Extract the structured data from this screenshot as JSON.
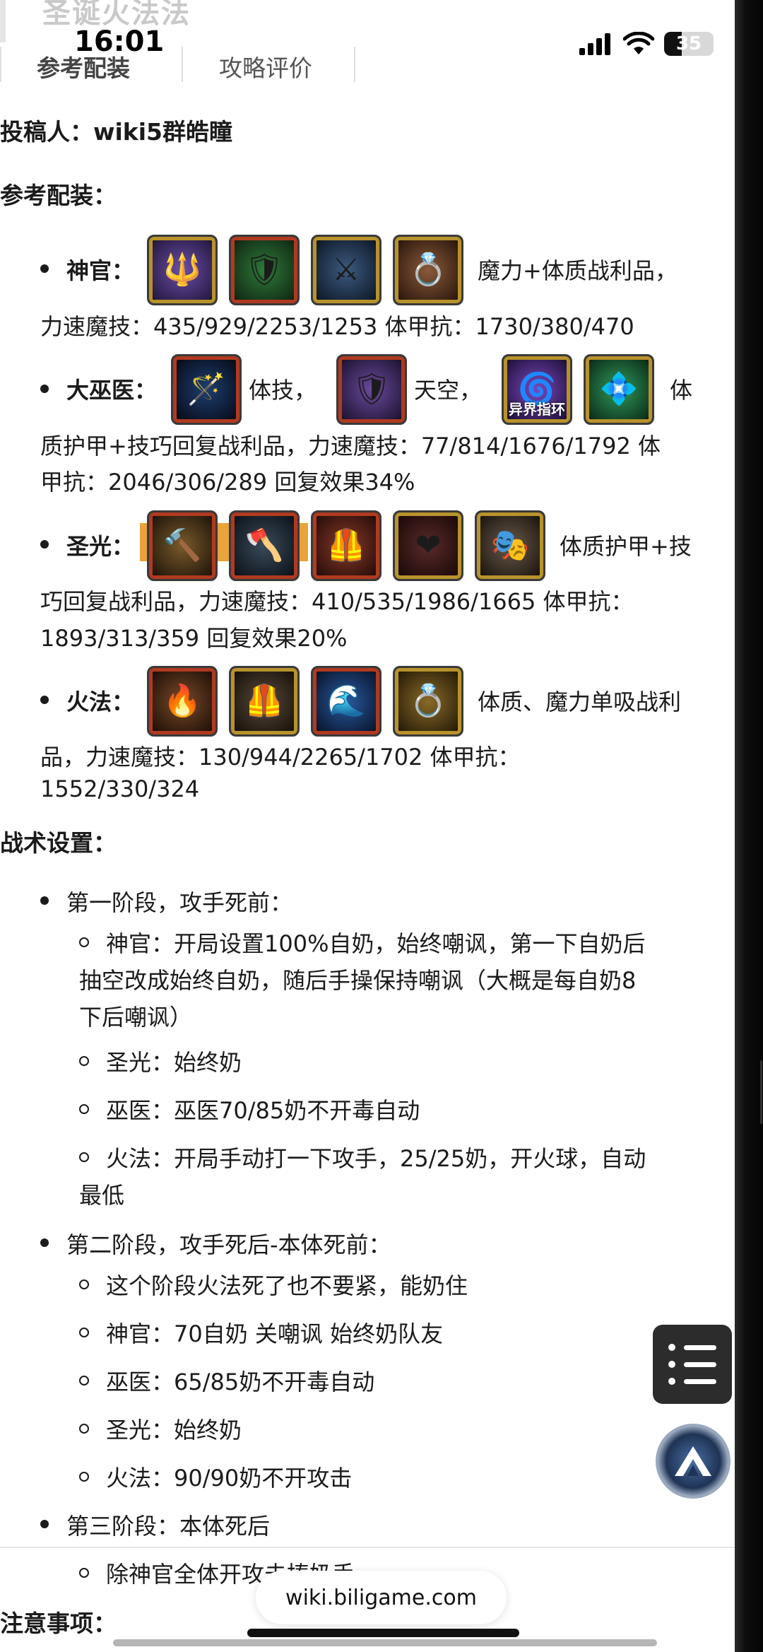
{
  "page": {
    "faded_title": "圣诞火法法",
    "url": "wiki.biligame.com"
  },
  "status_bar": {
    "time": "16:01",
    "battery": "35",
    "battery_level": 0.35
  },
  "tabs": [
    "参考配装",
    "攻略评价"
  ],
  "author": "投稿人：wiki5群皓瞳",
  "section_gear": "参考配装：",
  "priest": {
    "label": "神官：",
    "trail": "魔力+体质战利品，",
    "stats": "力速魔技：435/929/2253/1253 体甲抗：1730/380/470"
  },
  "shaman": {
    "label": "大巫医：",
    "t1": "体技，",
    "t2": "天空，",
    "t3": "体",
    "ring_tag": "异界指环",
    "line2": "质护甲+技巧回复战利品，力速魔技：77/814/1676/1792 体",
    "line3": "甲抗：2046/306/289 回复效果34%"
  },
  "paladin": {
    "label": "圣光：",
    "trail": "体质护甲+技",
    "line2": "巧回复战利品，力速魔技：410/535/1986/1665 体甲抗：",
    "line3": "1893/313/359 回复效果20%"
  },
  "firemage": {
    "label": "火法：",
    "trail": "体质、魔力单吸战利",
    "line2": "品，力速魔技：130/944/2265/1702 体甲抗：",
    "line3": "1552/330/324"
  },
  "section_tactics": "战术设置：",
  "phase1": {
    "title": "第一阶段，攻手死前：",
    "items": [
      "神官：开局设置100%自奶，始终嘲讽，第一下自奶后",
      "抽空改成始终自奶，随后手操保持嘲讽（大概是每自奶8",
      "下后嘲讽）",
      "圣光：始终奶",
      "巫医：巫医70/85奶不开毒自动",
      "火法：开局手动打一下攻手，25/25奶，开火球，自动",
      "最低"
    ]
  },
  "phase2": {
    "title": "第二阶段，攻手死后-本体死前：",
    "items": [
      "这个阶段火法死了也不要紧，能奶住",
      "神官：70自奶 关嘲讽 始终奶队友",
      "巫医：65/85奶不开毒自动",
      "圣光：始终奶",
      "火法：90/90奶不开攻击"
    ]
  },
  "phase3": {
    "title": "第三阶段：本体死后",
    "items": [
      "除神官全体开攻击捧奶手"
    ]
  },
  "section_notes": "注意事项：",
  "icons": {
    "priest": [
      "staff-icon",
      "chest-armor-icon",
      "dark-armor-icon",
      "ring-icon"
    ],
    "shaman": [
      "wand-icon",
      "purple-armor-icon",
      "purple-ring-icon",
      "green-gem-icon"
    ],
    "paladin": [
      "hammer-icon",
      "axe-icon",
      "red-armor-icon",
      "heart-amulet-icon",
      "mask-icon"
    ],
    "firemage": [
      "fire-staff-icon",
      "leather-armor-icon",
      "blue-claw-icon",
      "gold-ring-icon"
    ]
  }
}
